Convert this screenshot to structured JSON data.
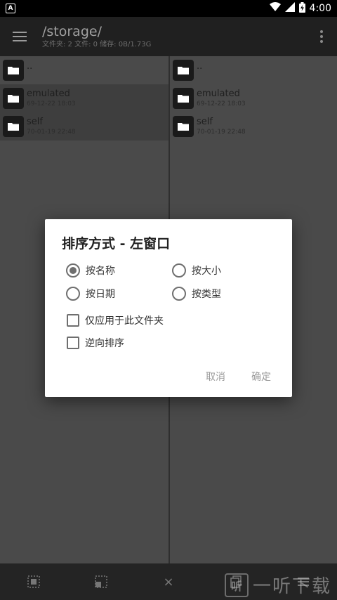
{
  "status_bar": {
    "time": "4:00",
    "notif_icon": "A"
  },
  "toolbar": {
    "title": "/storage/",
    "subtitle": "文件夹: 2  文件: 0  储存: 0B/1.73G"
  },
  "left_pane": {
    "rows": [
      {
        "name": "..",
        "date": ""
      },
      {
        "name": "emulated",
        "date": "69-12-22 18:03"
      },
      {
        "name": "self",
        "date": "70-01-19 22:48"
      }
    ]
  },
  "right_pane": {
    "rows": [
      {
        "name": "..",
        "date": ""
      },
      {
        "name": "emulated",
        "date": "69-12-22 18:03"
      },
      {
        "name": "self",
        "date": "70-01-19 22:48"
      }
    ]
  },
  "dialog": {
    "title": "排序方式 - 左窗口",
    "options": {
      "by_name": "按名称",
      "by_size": "按大小",
      "by_date": "按日期",
      "by_type": "按类型"
    },
    "selected": "by_name",
    "checkboxes": {
      "this_folder_only": "仅应用于此文件夹",
      "reverse": "逆向排序"
    },
    "cancel_label": "取消",
    "ok_label": "确定"
  },
  "bottom_bar": {
    "close_glyph": "×"
  },
  "watermark": {
    "logo": "听",
    "text": "一听下载"
  }
}
